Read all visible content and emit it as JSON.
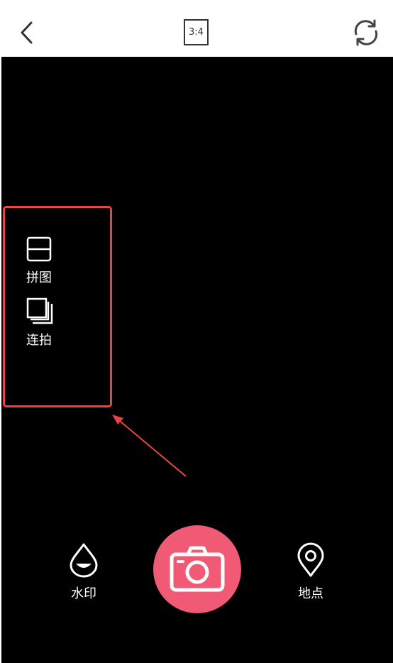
{
  "topbar": {
    "back_icon": "chevron-left-icon",
    "aspect_ratio": "3:4",
    "switch_icon": "camera-switch-icon"
  },
  "side_menu": {
    "items": [
      {
        "label": "拼图",
        "icon": "collage-icon"
      },
      {
        "label": "连拍",
        "icon": "burst-icon"
      }
    ]
  },
  "bottom_bar": {
    "watermark_label": "水印",
    "watermark_icon": "watermark-drop-icon",
    "shutter_icon": "camera-icon",
    "location_label": "地点",
    "location_icon": "location-pin-icon"
  },
  "colors": {
    "highlight_border": "#e84346",
    "shutter": "#f05a74",
    "viewfinder_bg": "#000000",
    "topbar_bg": "#ffffff"
  }
}
